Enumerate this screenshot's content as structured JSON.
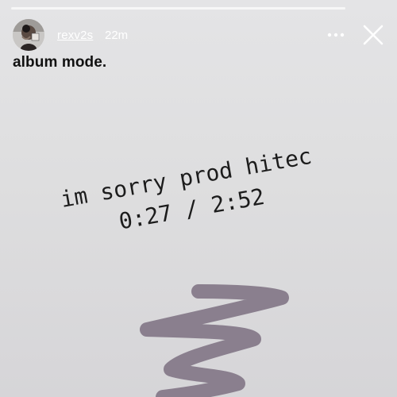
{
  "story": {
    "progress": 0.97
  },
  "header": {
    "username": "rexv2s",
    "timestamp": "22m",
    "more_icon": "more-horizontal-icon",
    "close_icon": "close-icon"
  },
  "caption": "album mode.",
  "sticker": {
    "title": "im sorry prod hitec",
    "time": "0:27 / 2:52"
  },
  "colors": {
    "squiggle": "#8a7f8e",
    "progress": "#f7f7f7"
  }
}
